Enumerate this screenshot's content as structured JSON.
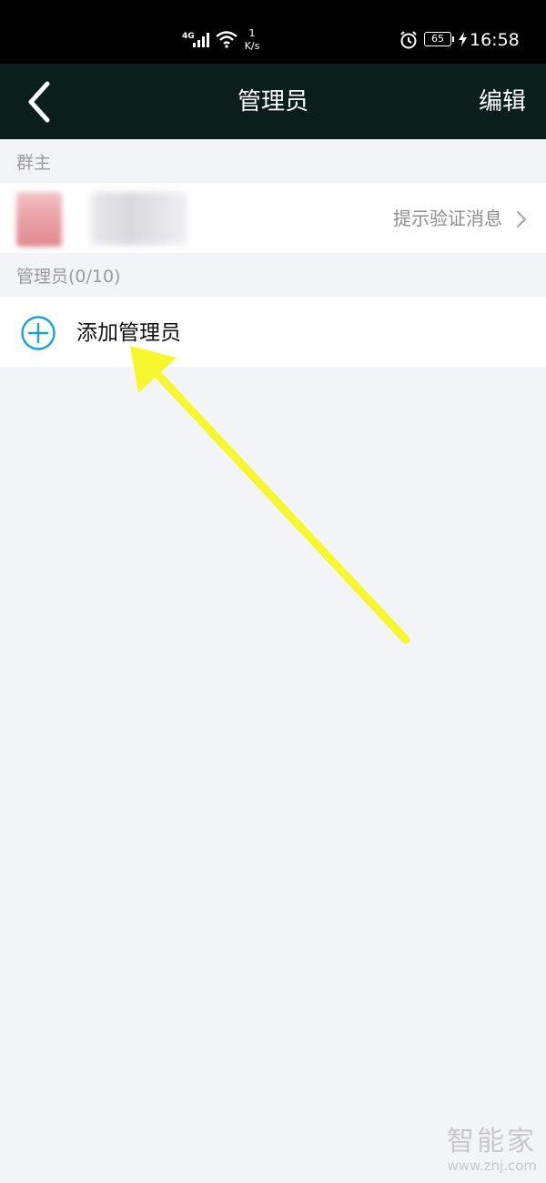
{
  "status_bar": {
    "network": "4G",
    "speed_value": "1",
    "speed_unit": "K/s",
    "battery": "65",
    "time": "16:58"
  },
  "nav": {
    "title": "管理员",
    "edit_label": "编辑"
  },
  "owner_section": {
    "header": "群主",
    "hint": "提示验证消息"
  },
  "admin_section": {
    "header": "管理员(0/10)",
    "add_label": "添加管理员"
  },
  "colors": {
    "nav_background": "#0a1f1c",
    "page_background": "#f3f4f8",
    "add_icon": "#1aa0d8",
    "annotation_arrow": "#f7f72e"
  },
  "icons": {
    "back": "chevron-left-icon",
    "chevron": "chevron-right-icon",
    "add": "plus-circle-icon",
    "alarm": "alarm-clock-icon"
  },
  "watermark": {
    "brand": "智能家",
    "url": "www.znj.com"
  }
}
